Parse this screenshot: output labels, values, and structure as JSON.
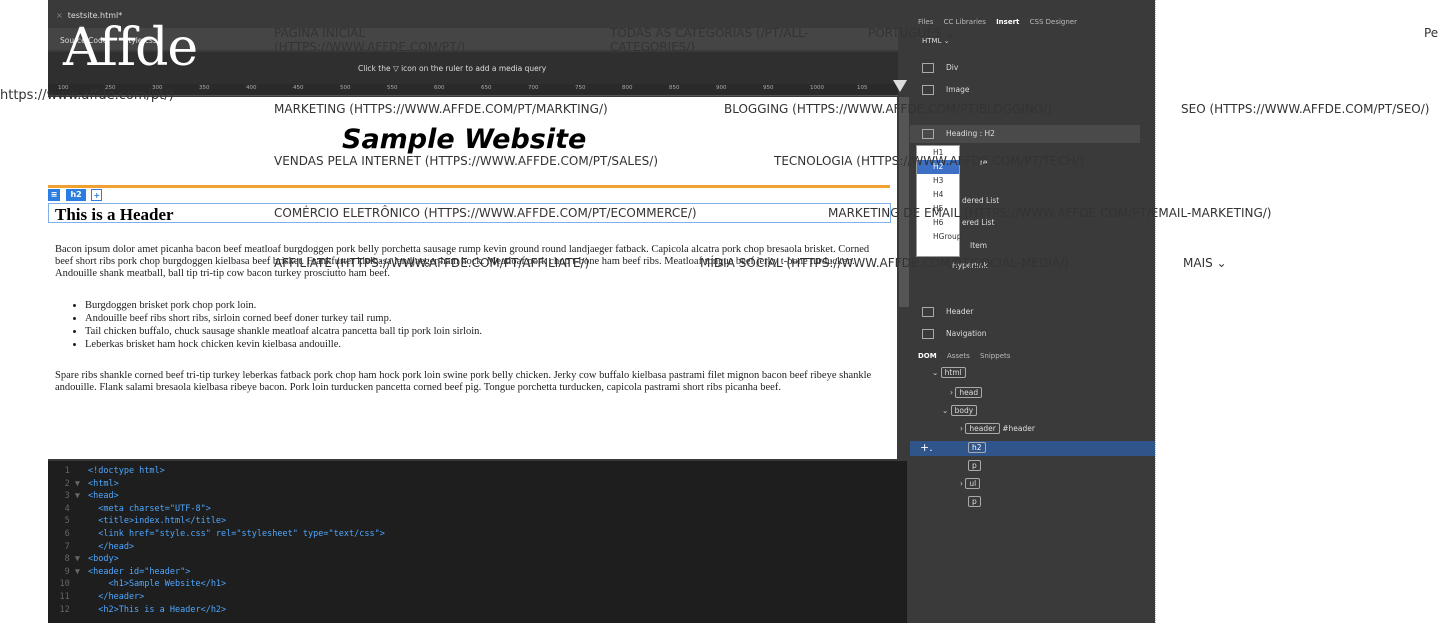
{
  "doc_tab": "testsite.html*",
  "sub_tabs": [
    "Source Code",
    "style.css"
  ],
  "mq_hint": "Click the  ▽  icon on the ruler to add a media query",
  "ruler_ticks": [
    "100",
    "250",
    "300",
    "350",
    "400",
    "450",
    "500",
    "550",
    "600",
    "650",
    "700",
    "750",
    "800",
    "850",
    "900",
    "950",
    "1000",
    "105"
  ],
  "design": {
    "site_title": "Sample Website",
    "selector_tag": "h2",
    "h2_text": "This is a Header",
    "paragraph1": "Bacon ipsum dolor amet picanha bacon beef meatloaf burgdoggen pork belly porchetta sausage rump kevin ground round landjaeger fatback. Capicola alcatra pork chop bresaola brisket. Corned beef short ribs pork chop burgdoggen kielbasa beef brisket. Frankfurter kielbasa landjaeger ham hock. Meatloaf pork chop t-bone ham beef ribs. Meatloaf tongue beef jerky t-bone turducken. Andouille shank meatball, ball tip tri-tip cow bacon turkey prosciutto ham beef.",
    "list": [
      "Burgdoggen brisket pork chop pork loin.",
      "Andouille beef ribs short ribs, sirloin corned beef doner turkey tail rump.",
      "Tail chicken buffalo, chuck sausage shankle meatloaf alcatra pancetta ball tip pork loin sirloin.",
      "Leberkas brisket ham hock chicken kevin kielbasa andouille."
    ],
    "paragraph2": "Spare ribs shankle corned beef tri-tip turkey leberkas fatback pork chop ham hock pork loin swine pork belly chicken. Jerky cow buffalo kielbasa pastrami filet mignon bacon beef ribeye shankle andouille. Flank salami bresaola kielbasa ribeye bacon. Pork loin turducken pancetta corned beef pig. Tongue porchetta turducken, capicola pastrami short ribs picanha beef."
  },
  "code": [
    {
      "n": "1",
      "arrow": "",
      "text": "<!doctype html>"
    },
    {
      "n": "2",
      "arrow": "▼",
      "text": "<html>"
    },
    {
      "n": "3",
      "arrow": "▼",
      "text": "<head>"
    },
    {
      "n": "4",
      "arrow": "",
      "text": "  <meta charset=\"UTF-8\">"
    },
    {
      "n": "5",
      "arrow": "",
      "text": "  <title>index.html</title>"
    },
    {
      "n": "6",
      "arrow": "",
      "text": "  <link href=\"style.css\" rel=\"stylesheet\" type=\"text/css\">"
    },
    {
      "n": "7",
      "arrow": "",
      "text": "  </head>"
    },
    {
      "n": "8",
      "arrow": "▼",
      "text": "<body>"
    },
    {
      "n": "9",
      "arrow": "▼",
      "text": "<header id=\"header\">"
    },
    {
      "n": "10",
      "arrow": "",
      "text": "    <h1>Sample Website</h1>"
    },
    {
      "n": "11",
      "arrow": "",
      "text": "  </header>"
    },
    {
      "n": "12",
      "arrow": "",
      "text": "  <h2>This is a Header</h2>"
    }
  ],
  "right_panel": {
    "tabs": [
      "Files",
      "CC Libraries",
      "Insert",
      "CSS Designer"
    ],
    "active_tab": "Insert",
    "category": "HTML",
    "insert_items": [
      "Div",
      "Image"
    ],
    "heading_row": "Heading : H2",
    "heading_menu": [
      "H1",
      "H2",
      "H3",
      "H4",
      "H5",
      "H6",
      "HGroup"
    ],
    "heading_selected": "H2",
    "partial_items": [
      "re",
      "dered List",
      "ered List",
      "Item",
      "Hyperlink"
    ],
    "lower_items": [
      "Header",
      "Navigation"
    ],
    "dom_tabs": [
      "DOM",
      "Assets",
      "Snippets"
    ],
    "dom_tree": [
      "html",
      "head",
      "body",
      "header",
      "#header",
      "h2",
      "p",
      "ul",
      "p"
    ]
  },
  "overlay": {
    "logo": "Affde",
    "logo_link": "https://www.affde.com/pt/)",
    "nav": [
      "PAGINA INICIAL (HTTPS://WWW.AFFDE.COM/PT/)",
      "TODAS AS CATEGORIAS (/PT/ALL-CATEGORIES/)",
      "PORTUGUÊS",
      "MARKETING (HTTPS://WWW.AFFDE.COM/PT/MARKTING/)",
      "BLOGGING (HTTPS://WWW.AFFDE.COM/PT/BLOGGING/)",
      "SEO (HTTPS://WWW.AFFDE.COM/PT/SEO/)",
      "VENDAS PELA INTERNET (HTTPS://WWW.AFFDE.COM/PT/SALES/)",
      "TECNOLOGIA (HTTPS://WWW.AFFDE.COM/PT/TECH/)",
      "COMÉRCIO ELETRÔNICO (HTTPS://WWW.AFFDE.COM/PT/ECOMMERCE/)",
      "MARKETING DE EMAIL (HTTPS://WWW.AFFDE.COM/PT/EMAIL-MARKETING/)",
      "AFFILIATE (HTTPS://WWW.AFFDE.COM/PT/AFFILIATE/)",
      "MÍDIA SOCIAL (HTTPS://WWW.AFFDE.COM/PT/SOCIAL-MEDIA/)",
      "MAIS"
    ],
    "right_partial": "Pe"
  }
}
